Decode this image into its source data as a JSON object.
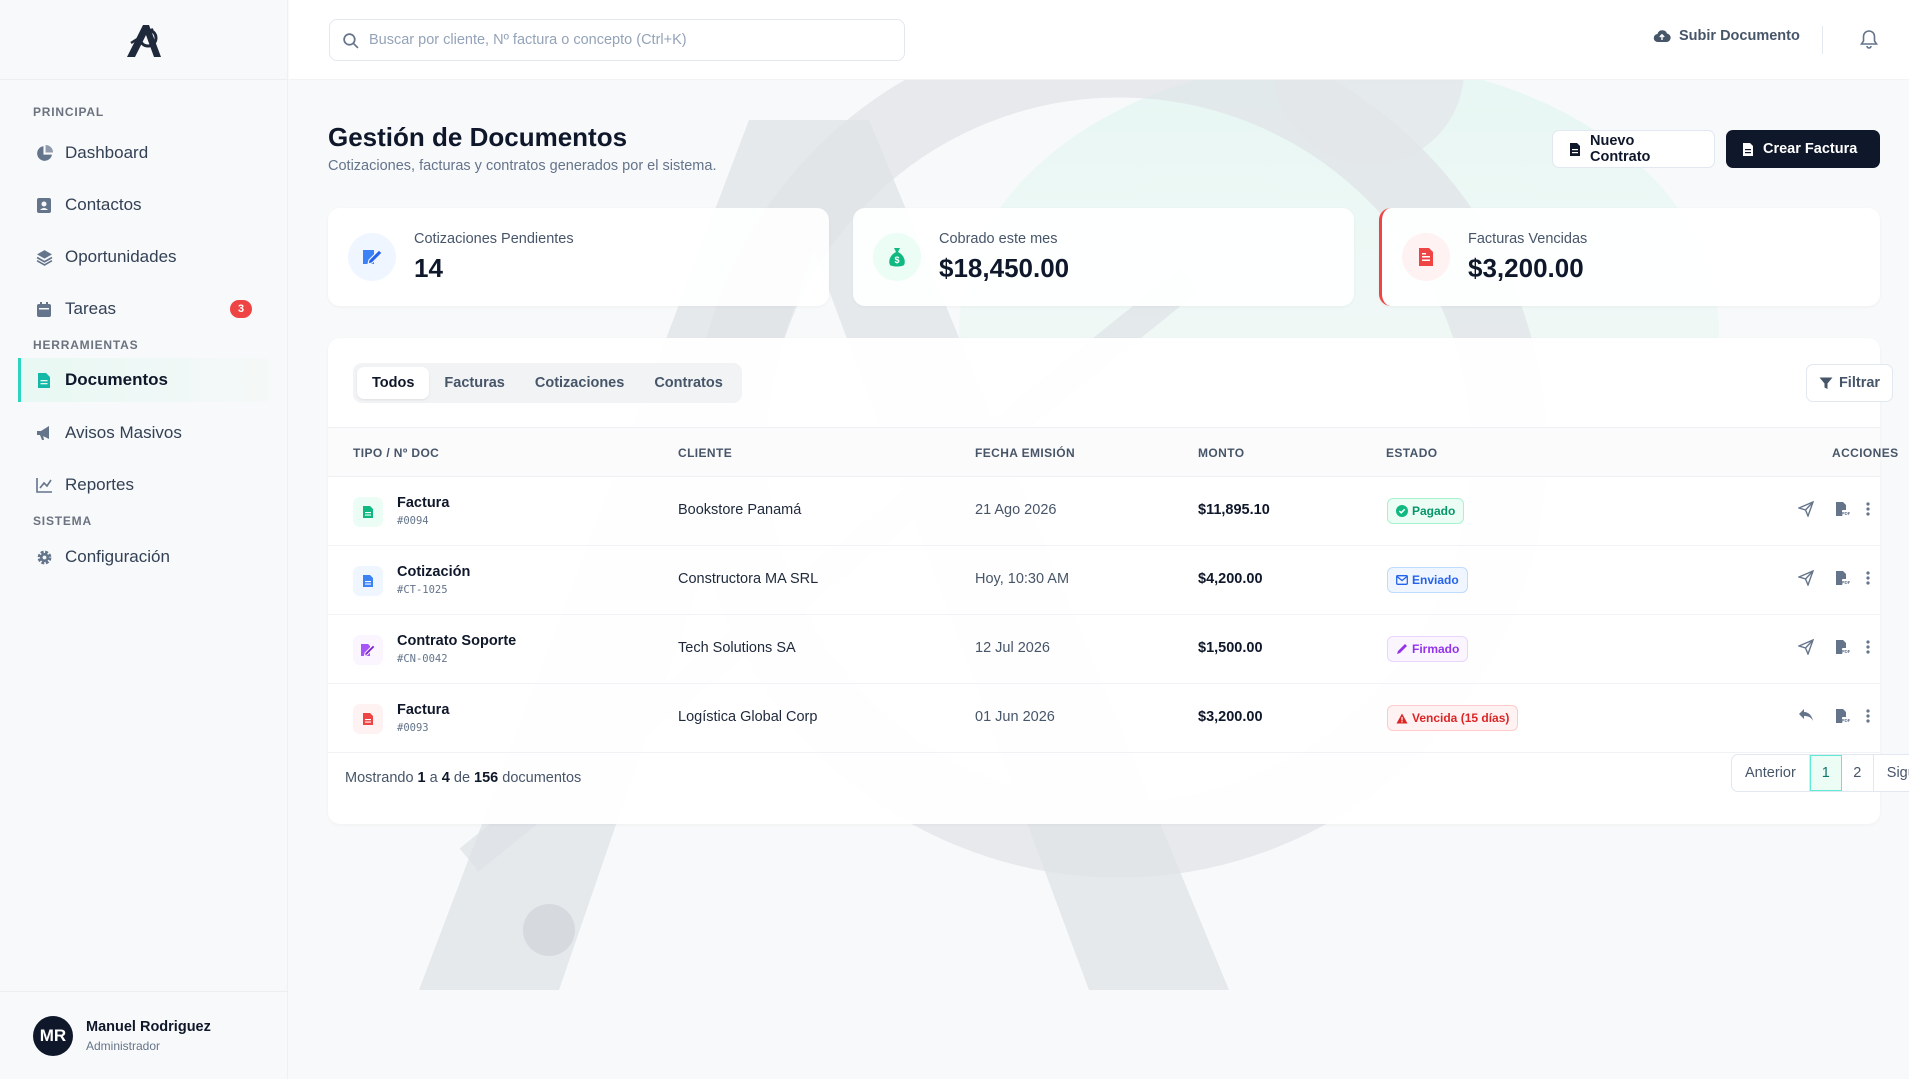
{
  "sidebar": {
    "sections": {
      "principal": "PRINCIPAL",
      "herramientas": "HERRAMIENTAS",
      "sistema": "SISTEMA"
    },
    "items": [
      {
        "label": "Dashboard",
        "icon": "pie-chart-icon"
      },
      {
        "label": "Contactos",
        "icon": "contact-book-icon"
      },
      {
        "label": "Oportunidades",
        "icon": "layers-icon"
      },
      {
        "label": "Tareas",
        "icon": "calendar-icon",
        "badge": "3"
      },
      {
        "label": "Documentos",
        "icon": "document-icon",
        "active": true
      },
      {
        "label": "Avisos Masivos",
        "icon": "megaphone-icon"
      },
      {
        "label": "Reportes",
        "icon": "line-chart-icon"
      },
      {
        "label": "Configuración",
        "icon": "gear-icon"
      }
    ],
    "user": {
      "initials": "MR",
      "name": "Manuel Rodriguez",
      "role": "Administrador"
    }
  },
  "topbar": {
    "search_placeholder": "Buscar por cliente, Nº factura o concepto (Ctrl+K)",
    "upload_label": "Subir Documento"
  },
  "header": {
    "title": "Gestión de Documentos",
    "subtitle": "Cotizaciones, facturas y contratos generados por el sistema.",
    "btn_contract": "Nuevo Contrato",
    "btn_invoice": "Crear Factura"
  },
  "stats": [
    {
      "label": "Cotizaciones Pendientes",
      "value": "14",
      "icon": "edit-document-icon",
      "color": "#3b82f6"
    },
    {
      "label": "Cobrado este mes",
      "value": "$18,450.00",
      "icon": "money-bag-icon",
      "color": "#10b981"
    },
    {
      "label": "Facturas Vencidas",
      "value": "$3,200.00",
      "icon": "invoice-icon",
      "color": "#ef4444"
    }
  ],
  "tabs": [
    "Todos",
    "Facturas",
    "Cotizaciones",
    "Contratos"
  ],
  "filter_label": "Filtrar",
  "table": {
    "headers": [
      "TIPO / Nº DOC",
      "CLIENTE",
      "FECHA EMISIÓN",
      "MONTO",
      "ESTADO",
      "ACCIONES"
    ],
    "rows": [
      {
        "type": "Factura",
        "num": "#0094",
        "client": "Bookstore Panamá",
        "date": "21 Ago 2026",
        "amount": "$11,895.10",
        "status": "Pagado",
        "status_kind": "green"
      },
      {
        "type": "Cotización",
        "num": "#CT-1025",
        "client": "Constructora MA SRL",
        "date": "Hoy, 10:30 AM",
        "amount": "$4,200.00",
        "status": "Enviado",
        "status_kind": "blue"
      },
      {
        "type": "Contrato Soporte",
        "num": "#CN-0042",
        "client": "Tech Solutions SA",
        "date": "12 Jul 2026",
        "amount": "$1,500.00",
        "status": "Firmado",
        "status_kind": "purple"
      },
      {
        "type": "Factura",
        "num": "#0093",
        "client": "Logística Global Corp",
        "date": "01 Jun 2026",
        "amount": "$3,200.00",
        "status": "Vencida (15 días)",
        "status_kind": "red"
      }
    ]
  },
  "footer": {
    "prefix": "Mostrando",
    "from": "1",
    "sep": "a",
    "to": "4",
    "of": "de",
    "total": "156",
    "suffix": "documentos"
  },
  "pagination": {
    "prev": "Anterior",
    "pages": [
      "1",
      "2"
    ],
    "next": "Siguiente"
  }
}
